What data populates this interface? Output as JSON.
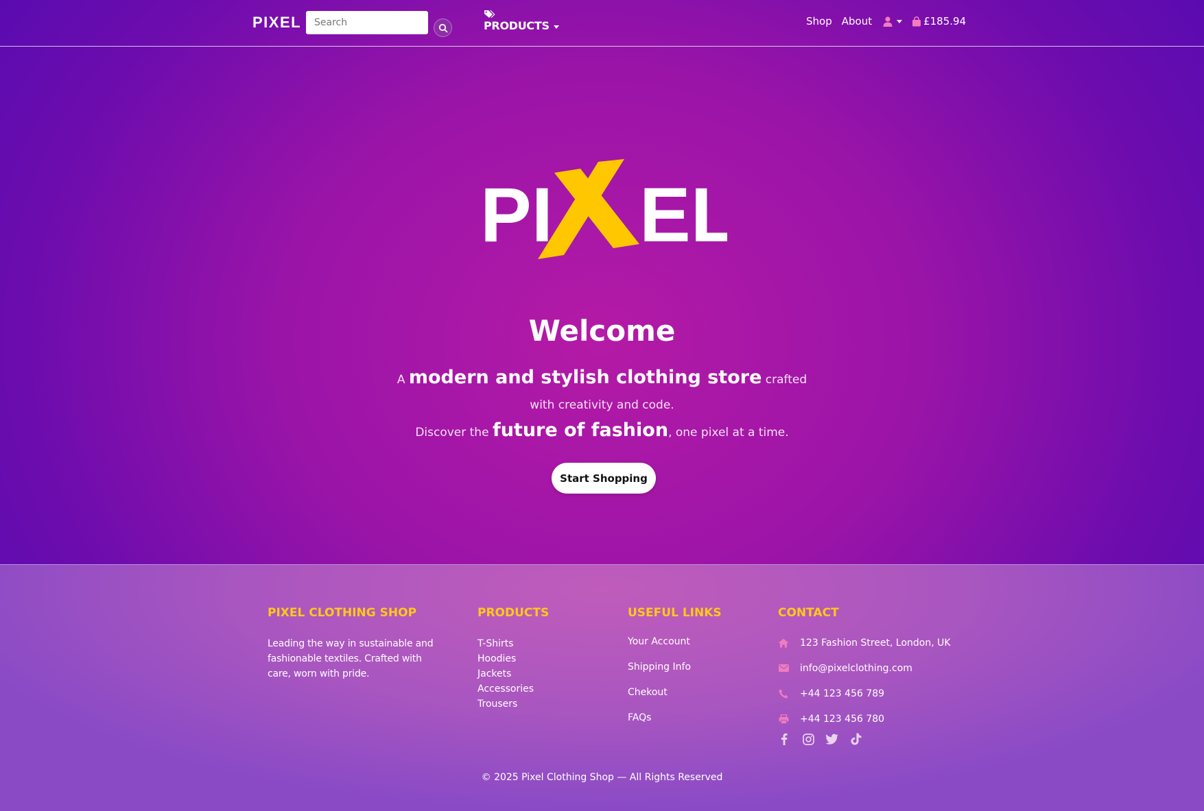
{
  "nav": {
    "brand": "PIXEL",
    "search_placeholder": "Search",
    "products_label": "PRODUCTS",
    "shop_label": "Shop",
    "about_label": "About",
    "cart_total": "£185.94"
  },
  "hero": {
    "logo": "PIXEL",
    "logo_accent_color": "#ffc700",
    "title": "Welcome",
    "line1_pre": "A",
    "line1_big": "modern and stylish clothing store",
    "line1_post": "crafted",
    "line2": "with creativity and code.",
    "line3_pre": "Discover the",
    "line3_big": "future of fashion",
    "line3_post": ", one pixel at a time.",
    "cta_label": "Start Shopping"
  },
  "footer": {
    "shop": {
      "heading": "PIXEL CLOTHING SHOP",
      "text": "Leading the way in sustainable and fashionable textiles. Crafted with care, worn with pride."
    },
    "products": {
      "heading": "PRODUCTS",
      "items": [
        "T-Shirts",
        "Hoodies",
        "Jackets",
        "Accessories",
        "Trousers"
      ]
    },
    "links": {
      "heading": "USEFUL LINKS",
      "items": [
        "Your Account",
        "Shipping Info",
        "Chekout",
        "FAQs"
      ]
    },
    "contact": {
      "heading": "CONTACT",
      "address": "123 Fashion Street, London, UK",
      "email": "info@pixelclothing.com",
      "phone": "+44 123 456 789",
      "fax": "+44 123 456 780"
    },
    "socials": [
      "facebook-icon",
      "instagram-icon",
      "twitter-icon",
      "tiktok-icon"
    ],
    "copyright": "© 2025 Pixel Clothing Shop — All Rights Reserved"
  },
  "colors": {
    "accent": "#ffc81a",
    "icon_pink": "#f07cbf"
  }
}
